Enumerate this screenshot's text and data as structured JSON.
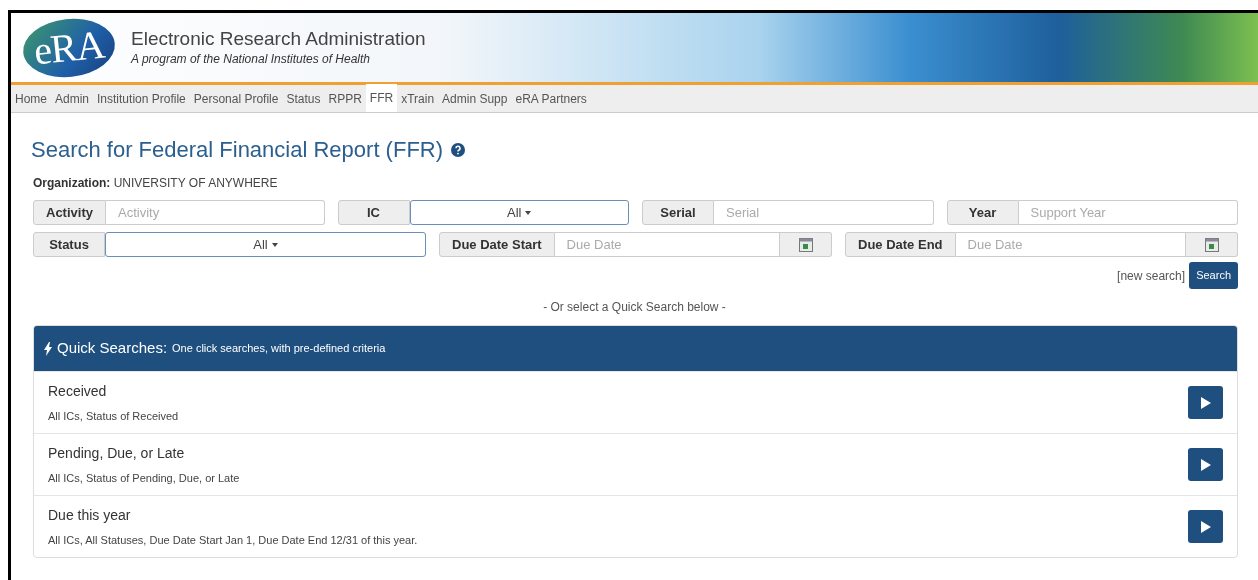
{
  "header": {
    "logo": "eRA",
    "title": "Electronic Research Administration",
    "subtitle": "A program of the National Institutes of Health"
  },
  "nav": [
    {
      "label": "Home",
      "selected": false
    },
    {
      "label": "Admin",
      "selected": false
    },
    {
      "label": "Institution Profile",
      "selected": false
    },
    {
      "label": "Personal Profile",
      "selected": false
    },
    {
      "label": "Status",
      "selected": false
    },
    {
      "label": "RPPR",
      "selected": false
    },
    {
      "label": "FFR",
      "selected": true
    },
    {
      "label": "xTrain",
      "selected": false
    },
    {
      "label": "Admin Supp",
      "selected": false
    },
    {
      "label": "eRA Partners",
      "selected": false
    }
  ],
  "page_title": "Search for Federal Financial Report (FFR)",
  "organization": {
    "label": "Organization:",
    "value": "UNIVERSITY OF ANYWHERE"
  },
  "filter_rows": [
    [
      {
        "kind": "text",
        "label": "Activity",
        "placeholder": "Activity"
      },
      {
        "kind": "select",
        "label": "IC",
        "value": "All"
      },
      {
        "kind": "text",
        "label": "Serial",
        "placeholder": "Serial"
      },
      {
        "kind": "text",
        "label": "Year",
        "placeholder": "Support Year"
      }
    ],
    [
      {
        "kind": "select",
        "label": "Status",
        "value": "All"
      },
      {
        "kind": "date",
        "label": "Due Date Start",
        "placeholder": "Due Date"
      },
      {
        "kind": "date",
        "label": "Due Date End",
        "placeholder": "Due Date"
      }
    ]
  ],
  "new_search_link": "[new search]",
  "search_button": "Search",
  "divider_text": "- Or select a Quick Search below -",
  "quick_searches": {
    "title": "Quick Searches:",
    "subtitle": "One click searches, with pre-defined criteria",
    "items": [
      {
        "name": "Received",
        "description": "All ICs, Status of Received"
      },
      {
        "name": "Pending, Due, or Late",
        "description": "All ICs, Status of Pending, Due, or Late"
      },
      {
        "name": "Due this year",
        "description": "All ICs, All Statuses, Due Date Start Jan 1, Due Date End 12/31 of this year."
      }
    ]
  }
}
